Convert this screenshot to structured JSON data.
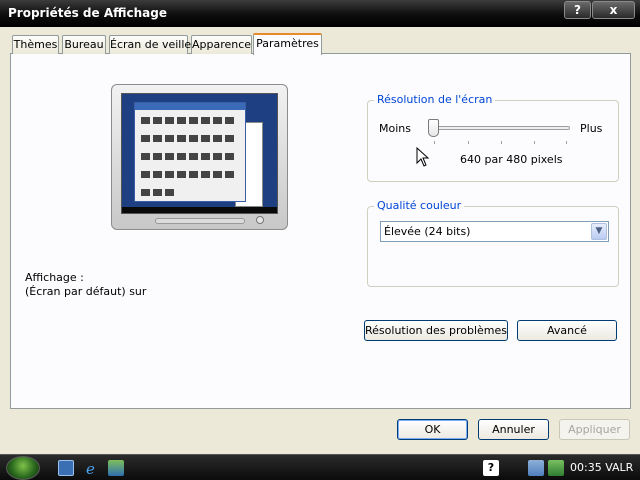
{
  "window": {
    "title": "Propriétés de Affichage",
    "help_label": "?",
    "close_label": "x"
  },
  "tabs": [
    {
      "label": "Thèmes"
    },
    {
      "label": "Bureau"
    },
    {
      "label": "Écran de veille"
    },
    {
      "label": "Apparence"
    },
    {
      "label": "Paramètres",
      "active": true
    }
  ],
  "display": {
    "label_line1": "Affichage :",
    "label_line2": "(Écran par défaut) sur"
  },
  "resolution": {
    "legend": "Résolution de l'écran",
    "less_label": "Moins",
    "more_label": "Plus",
    "value_text": "640 par 480 pixels",
    "slider_position": 0
  },
  "color_quality": {
    "legend": "Qualité couleur",
    "selected": "Élevée (24 bits)"
  },
  "buttons": {
    "troubleshoot": "Résolution des problèmes",
    "advanced": "Avancé",
    "ok": "OK",
    "cancel": "Annuler",
    "apply": "Appliquer"
  },
  "taskbar": {
    "clock": "00:35 VALR"
  },
  "colors": {
    "legend_blue": "#0046d5",
    "tab_highlight": "#e68b2c",
    "dialog_bg": "#ece9d8"
  }
}
